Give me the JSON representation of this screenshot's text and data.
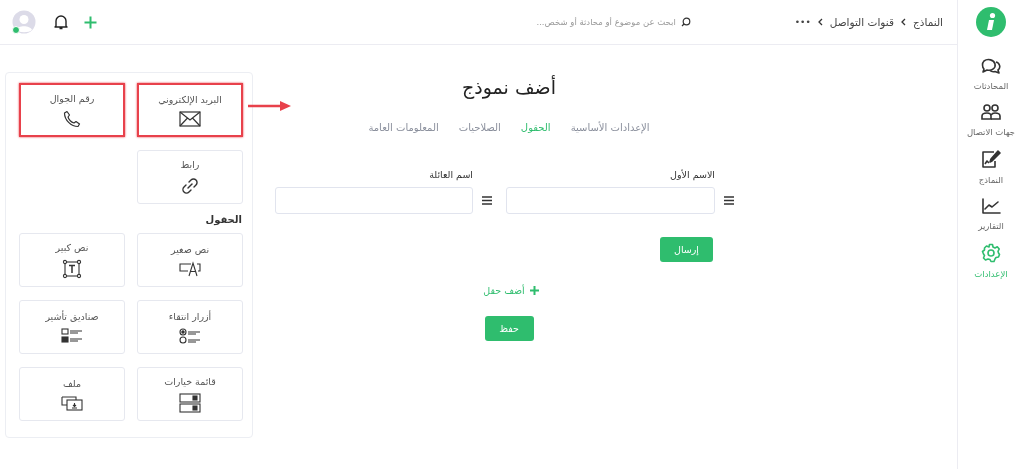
{
  "topbar": {
    "search": {
      "placeholder": "ابحث عن موضوع أو محادثة أو شخص..."
    },
    "breadcrumb": [
      "النماذج",
      "قنوات التواصل"
    ],
    "more": "•••",
    "user_online": true
  },
  "sidebar": {
    "items": [
      {
        "label": "المحادثات",
        "kind": "chat",
        "selected": false
      },
      {
        "label": "جهات الاتصال",
        "kind": "contacts",
        "selected": false
      },
      {
        "label": "النماذج",
        "kind": "forms",
        "selected": false
      },
      {
        "label": "التقارير",
        "kind": "reports",
        "selected": false
      },
      {
        "label": "الإعدادات",
        "kind": "settings",
        "selected": true
      }
    ]
  },
  "page": {
    "title": "أضف نموذج",
    "tabs": [
      {
        "label": "الإعدادات الأساسية",
        "selected": false
      },
      {
        "label": "الحقول",
        "selected": true
      },
      {
        "label": "الصلاحيات",
        "selected": false
      },
      {
        "label": "المعلومات العامة",
        "selected": false
      }
    ],
    "fields": [
      {
        "label": "الاسم الأول"
      },
      {
        "label": "اسم العائلة"
      }
    ],
    "submit": "إرسال",
    "add_field": "أضف حقل",
    "save": "حفظ"
  },
  "palette": {
    "sections": [
      {
        "tiles": [
          {
            "label": "البريد الإلكتروني",
            "kind": "email",
            "highlighted": true
          },
          {
            "label": "رقم الجوال",
            "kind": "phone",
            "highlighted": true
          },
          {
            "label": "رابط",
            "kind": "link",
            "highlighted": false
          }
        ]
      },
      {
        "heading": "الحقول",
        "tiles": [
          {
            "label": "نص صغير",
            "kind": "short-text",
            "highlighted": false
          },
          {
            "label": "نص كبير",
            "kind": "long-text",
            "highlighted": false
          },
          {
            "label": "أزرار انتقاء",
            "kind": "radio",
            "highlighted": false
          },
          {
            "label": "صناديق تأشير",
            "kind": "checkbox",
            "highlighted": false
          },
          {
            "label": "قائمة خيارات",
            "kind": "select",
            "highlighted": false
          },
          {
            "label": "ملف",
            "kind": "file",
            "highlighted": false
          }
        ]
      }
    ]
  }
}
